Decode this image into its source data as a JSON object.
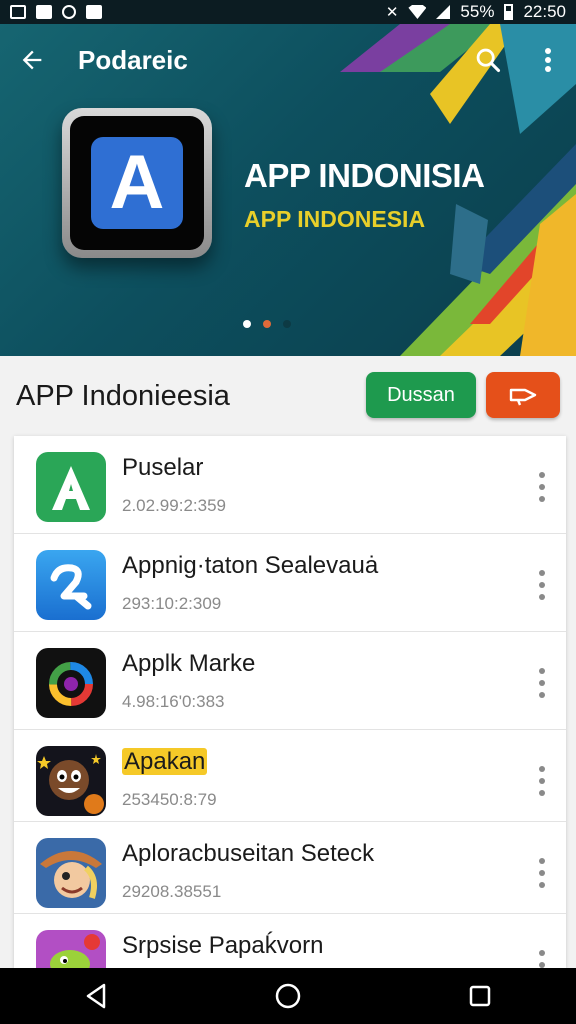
{
  "status_bar": {
    "battery": "55%",
    "time": "22:50"
  },
  "toolbar": {
    "title": "Podareic",
    "back_icon": "arrow-left-icon",
    "search_icon": "search-icon",
    "overflow_icon": "more-vert-icon"
  },
  "hero": {
    "title": "APP INDONISIA",
    "subtitle": "APP INDONESIA",
    "app_letter": "A",
    "page_dots": 3,
    "active_dot": 1,
    "colors": {
      "background": "#0d4f5e",
      "subtitle": "#e8cf2a"
    }
  },
  "section": {
    "title": "APP Indonieesia",
    "primary_button": "Dussan",
    "secondary_button_icon": "share-icon",
    "colors": {
      "primary": "#1e9a4e",
      "secondary": "#e5501a"
    }
  },
  "apps": [
    {
      "name": "Puselar",
      "meta": "2.02.99:2:359",
      "icon": "green-a-icon"
    },
    {
      "name": "Appnig·taton Sealevauȧ",
      "meta": "293:10:2:309",
      "icon": "blue-z-icon"
    },
    {
      "name": "Applk Marke",
      "meta": "4.98:16'0:383",
      "icon": "colorful-g-icon"
    },
    {
      "name": "Apakan",
      "meta": "253450:8:79",
      "icon": "cartoon-face-icon",
      "highlighted": true
    },
    {
      "name": "Aploracbuseitan Seteck",
      "meta": "29208.38551",
      "icon": "cartoon-pirate-icon"
    },
    {
      "name": "Srpsise Papaḱvorn",
      "meta": "",
      "icon": "cartoon-bird-icon"
    }
  ],
  "nav": {
    "back": "nav-back-icon",
    "home": "nav-home-icon",
    "recents": "nav-recents-icon"
  }
}
